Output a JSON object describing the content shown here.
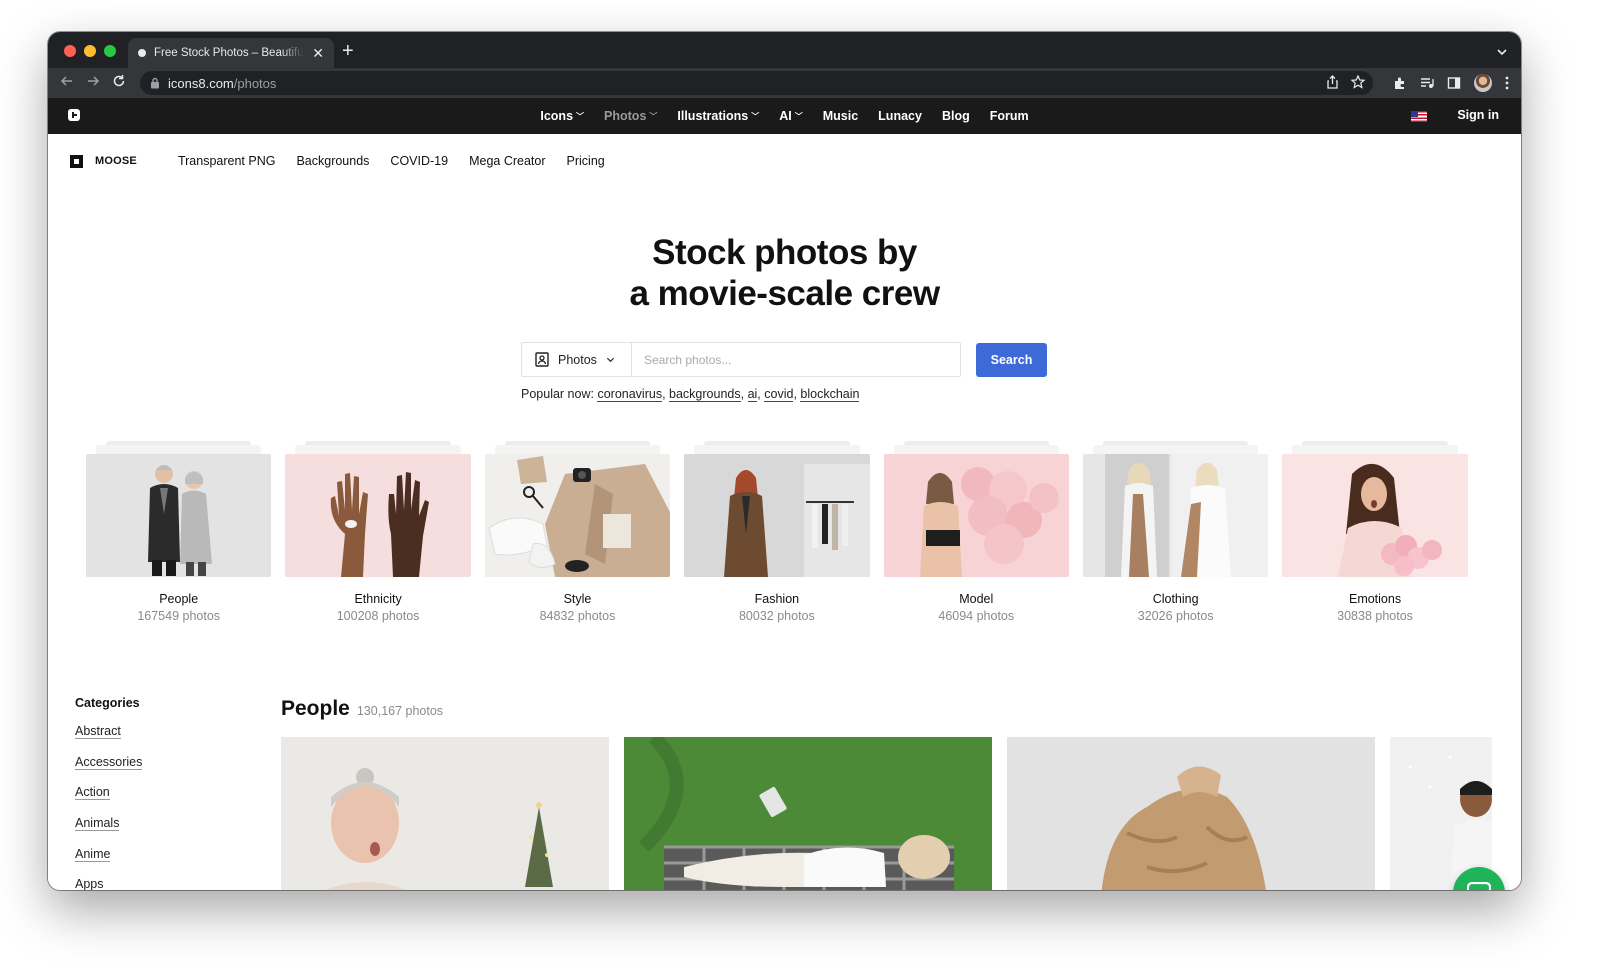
{
  "browser": {
    "tab_title": "Free Stock Photos – Beautiful People, Backgrounds",
    "url_host": "icons8.com",
    "url_path": "/photos"
  },
  "site_nav": {
    "items": [
      {
        "label": "Icons",
        "dropdown": true,
        "active": false
      },
      {
        "label": "Photos",
        "dropdown": true,
        "active": true
      },
      {
        "label": "Illustrations",
        "dropdown": true,
        "active": false
      },
      {
        "label": "AI",
        "dropdown": true,
        "active": false
      },
      {
        "label": "Music",
        "dropdown": false,
        "active": false
      },
      {
        "label": "Lunacy",
        "dropdown": false,
        "active": false
      },
      {
        "label": "Blog",
        "dropdown": false,
        "active": false
      },
      {
        "label": "Forum",
        "dropdown": false,
        "active": false
      }
    ],
    "sign_in": "Sign in"
  },
  "sub_nav": {
    "brand": "MOOSE",
    "links": [
      "Transparent PNG",
      "Backgrounds",
      "COVID-19",
      "Mega Creator",
      "Pricing"
    ]
  },
  "hero": {
    "title_line1": "Stock photos by",
    "title_line2": "a movie-scale crew"
  },
  "search": {
    "type_label": "Photos",
    "placeholder": "Search photos...",
    "button": "Search"
  },
  "popular": {
    "prefix": "Popular now:",
    "terms": [
      "coronavirus",
      "backgrounds",
      "ai",
      "covid",
      "blockchain"
    ]
  },
  "categories_cards": [
    {
      "name": "People",
      "count": "167549 photos",
      "bg": "#e3e3e3"
    },
    {
      "name": "Ethnicity",
      "count": "100208 photos",
      "bg": "#f6dede"
    },
    {
      "name": "Style",
      "count": "84832 photos",
      "bg": "#f0efec"
    },
    {
      "name": "Fashion",
      "count": "80032 photos",
      "bg": "#dadada"
    },
    {
      "name": "Model",
      "count": "46094 photos",
      "bg": "#f8d3d5"
    },
    {
      "name": "Clothing",
      "count": "32026 photos",
      "bg": "#e6e6e6"
    },
    {
      "name": "Emotions",
      "count": "30838 photos",
      "bg": "#f9e3e3"
    }
  ],
  "sidebar": {
    "heading": "Categories",
    "items": [
      "Abstract",
      "Accessories",
      "Action",
      "Animals",
      "Anime",
      "Apps"
    ]
  },
  "section": {
    "title": "People",
    "count": "130,167 photos"
  },
  "colors": {
    "accent": "#3d6ad6",
    "site_nav_bg": "#1a1a1a",
    "chat": "#1fb35a"
  }
}
